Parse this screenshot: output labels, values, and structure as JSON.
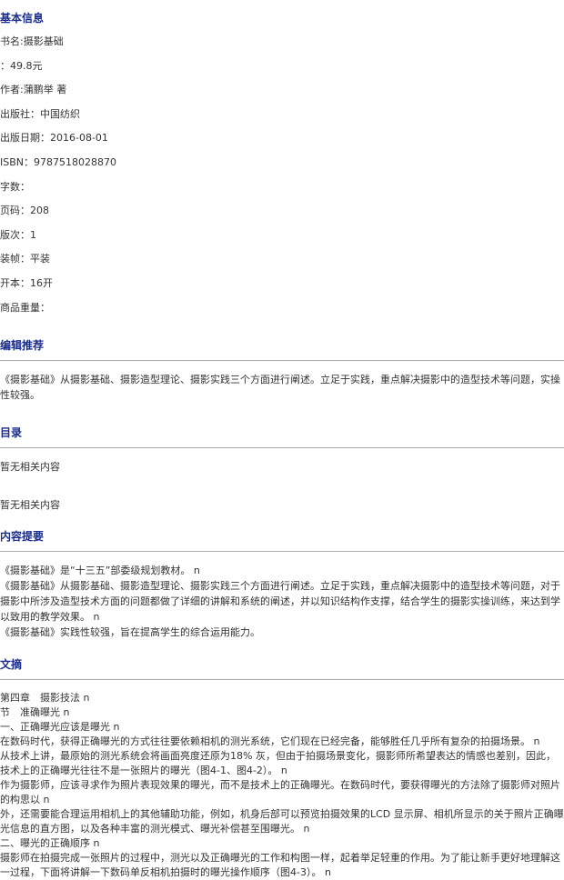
{
  "basic": {
    "title": "基本信息",
    "fields": [
      "书名:摄影基础",
      "：49.8元",
      "作者:蒲鹏举 著",
      "出版社：中国纺织",
      "出版日期：2016-08-01",
      "ISBN：9787518028870",
      "字数：",
      "页码：208",
      "版次：1",
      "装帧：平装",
      "开本：16开",
      "商品重量："
    ]
  },
  "editor": {
    "title": "编辑推荐",
    "text": "《摄影基础》从摄影基础、摄影造型理论、摄影实践三个方面进行阐述。立足于实践，重点解决摄影中的造型技术等问题，实操性较强。"
  },
  "toc": {
    "title": "目录",
    "line1": "暂无相关内容",
    "line2": "暂无相关内容"
  },
  "summary": {
    "title": "内容提要",
    "lines": [
      "《摄影基础》是“十三五”部委级规划教材。 n",
      "《摄影基础》从摄影基础、摄影造型理论、摄影实践三个方面进行阐述。立足于实践，重点解决摄影中的造型技术等问题，对于摄影中所涉及造型技术方面的问题都做了详细的讲解和系统的阐述，并以知识结构作支撑，结合学生的摄影实操训练，来达到学以致用的教学效果。 n",
      "《摄影基础》实践性较强，旨在提高学生的综合运用能力。"
    ]
  },
  "excerpt": {
    "title": "文摘",
    "lines": [
      "第四章　摄影技法 n",
      "节　准确曝光 n",
      "一、正确曝光应该是曝光 n",
      "在数码时代，获得正确曝光的方式往往要依赖相机的测光系统，它们现在已经完备，能够胜任几乎所有复杂的拍摄场景。 n",
      "从技术上讲，最原始的测光系统会将画面亮度还原为18% 灰，但由于拍摄场景变化，摄影师所希望表达的情感也差别，因此，技术上的正确曝光往往不是一张照片的曝光（图4-1、图4-2）。 n",
      "作为摄影师，应该寻求作为照片表现效果的曝光，而不是技术上的正确曝光。在数码时代，要获得曝光的方法除了摄影师对照片的构思以 n",
      "外，还需要能合理运用相机上的其他辅助功能，例如，机身后部可以预览拍摄效果的LCD 显示屏、相机所显示的关于照片正确曝光信息的直方图，以及各种丰富的测光模式、曝光补偿甚至围曝光。 n",
      "二、曝光的正确顺序 n",
      "摄影师在拍摄完成一张照片的过程中，测光以及正确曝光的工作和构图一样，起着举足轻重的作用。为了能让新手更好地理解这一过程，下面将讲解一下数码单反相机拍摄时的曝光操作顺序（图4-3）。 n"
    ]
  }
}
